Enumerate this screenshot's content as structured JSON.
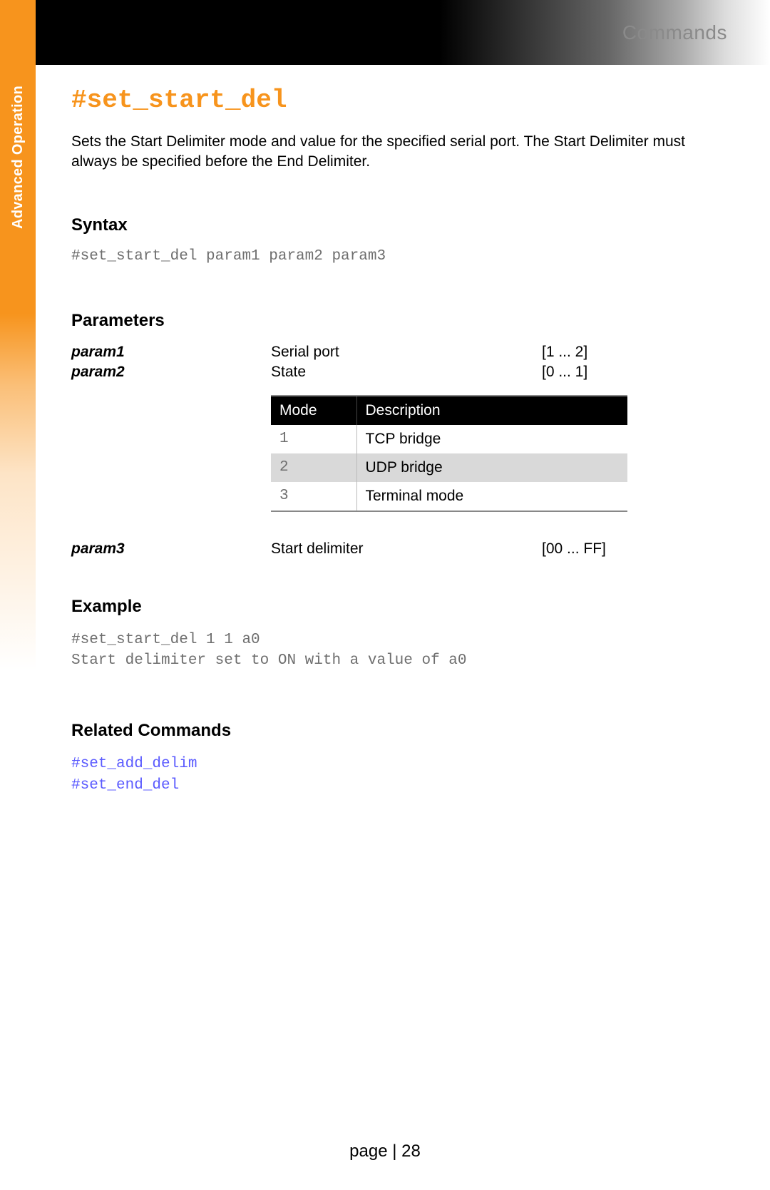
{
  "header": {
    "section": "Commands"
  },
  "sidebar": {
    "label": "Advanced Operation"
  },
  "command": {
    "title": "#set_start_del",
    "description": "Sets the Start Delimiter mode and value for the specified serial port. The Start Delimiter must always be specified before the End Delimiter."
  },
  "syntax": {
    "heading": "Syntax",
    "line": "#set_start_del param1 param2 param3"
  },
  "parameters": {
    "heading": "Parameters",
    "rows": [
      {
        "name": "param1",
        "desc": "Serial port",
        "range": "[1 ... 2]"
      },
      {
        "name": "param2",
        "desc": "State",
        "range": "[0 ... 1]"
      }
    ],
    "mode_table": {
      "headers": {
        "mode": "Mode",
        "desc": "Description"
      },
      "rows": [
        {
          "mode": "1",
          "desc": "TCP bridge"
        },
        {
          "mode": "2",
          "desc": "UDP bridge"
        },
        {
          "mode": "3",
          "desc": "Terminal mode"
        }
      ]
    },
    "rows_after": [
      {
        "name": "param3",
        "desc": "Start delimiter",
        "range": "[00 ... FF]"
      }
    ]
  },
  "example": {
    "heading": "Example",
    "lines": [
      "#set_start_del 1 1 a0",
      "Start delimiter set to ON with a value of a0"
    ]
  },
  "related": {
    "heading": "Related Commands",
    "links": [
      "#set_add_delim",
      "#set_end_del"
    ]
  },
  "footer": {
    "page_label": "page | 28"
  }
}
